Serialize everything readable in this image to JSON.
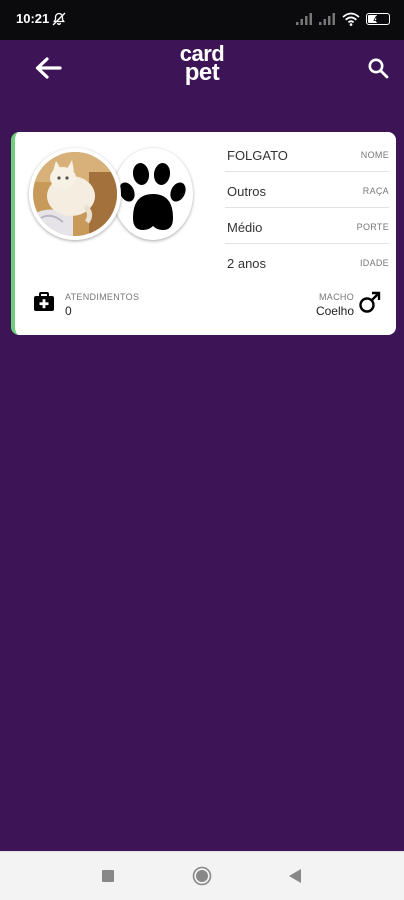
{
  "status_bar": {
    "time": "10:21",
    "battery": "40",
    "icons": [
      "notification-icon",
      "signal-icon",
      "signal-icon-2",
      "wifi-icon",
      "battery-icon"
    ]
  },
  "app_bar": {
    "logo_top": "card",
    "logo_bottom": "pet",
    "icons": [
      "back-arrow-icon",
      "search-icon"
    ]
  },
  "pet_card": {
    "accent_color": "#6ed07a",
    "fields": [
      {
        "value": "FOLGATO",
        "label": "NOME"
      },
      {
        "value": "Outros",
        "label": "RAÇA"
      },
      {
        "value": "Médio",
        "label": "PORTE"
      },
      {
        "value": "2 anos",
        "label": "IDADE"
      }
    ],
    "appointments_label": "ATENDIMENTOS",
    "appointments_count": "0",
    "sex_label": "MACHO",
    "species": "Coelho",
    "icons": [
      "pet-photo",
      "paw-icon",
      "medical-kit-icon",
      "male-icon"
    ]
  },
  "nav_bar": {
    "icons": [
      "recent-apps-icon",
      "home-icon",
      "back-icon"
    ]
  },
  "colors": {
    "background": "#3d1557",
    "status_bar": "#0b0b0d",
    "card": "#ffffff",
    "nav_bar": "#f3f3f3"
  }
}
